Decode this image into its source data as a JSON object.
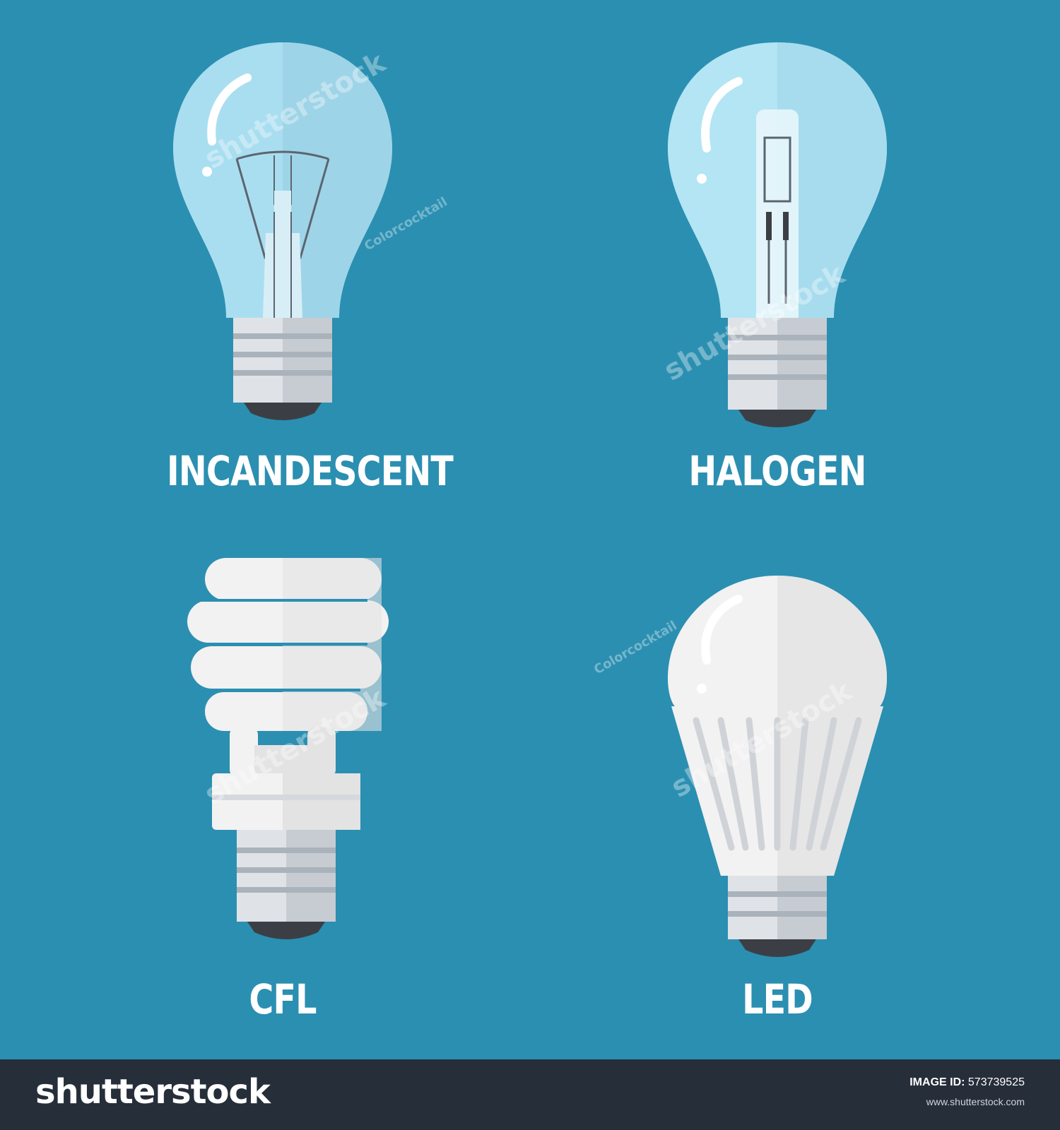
{
  "background_color": "#2b8fb1",
  "bulbs": [
    {
      "name": "incandescent",
      "label": "INCANDESCENT"
    },
    {
      "name": "halogen",
      "label": "HALOGEN"
    },
    {
      "name": "cfl",
      "label": "CFL"
    },
    {
      "name": "led",
      "label": "LED"
    }
  ],
  "watermark": {
    "brand": "shutterstock",
    "artist": "Colorcocktail"
  },
  "footer": {
    "logo": "shutterstock",
    "image_id_label": "IMAGE ID:",
    "image_id": "573739525",
    "url": "www.shutterstock.com"
  },
  "colors": {
    "glass": "#a9def0",
    "glass_dark": "#9fd3e6",
    "base_light": "#dfe3e7",
    "base_dark": "#c6ccd2",
    "tip": "#3b3f45",
    "white_bulb": "#f2f2f2",
    "footer_bg": "#262e3a"
  }
}
